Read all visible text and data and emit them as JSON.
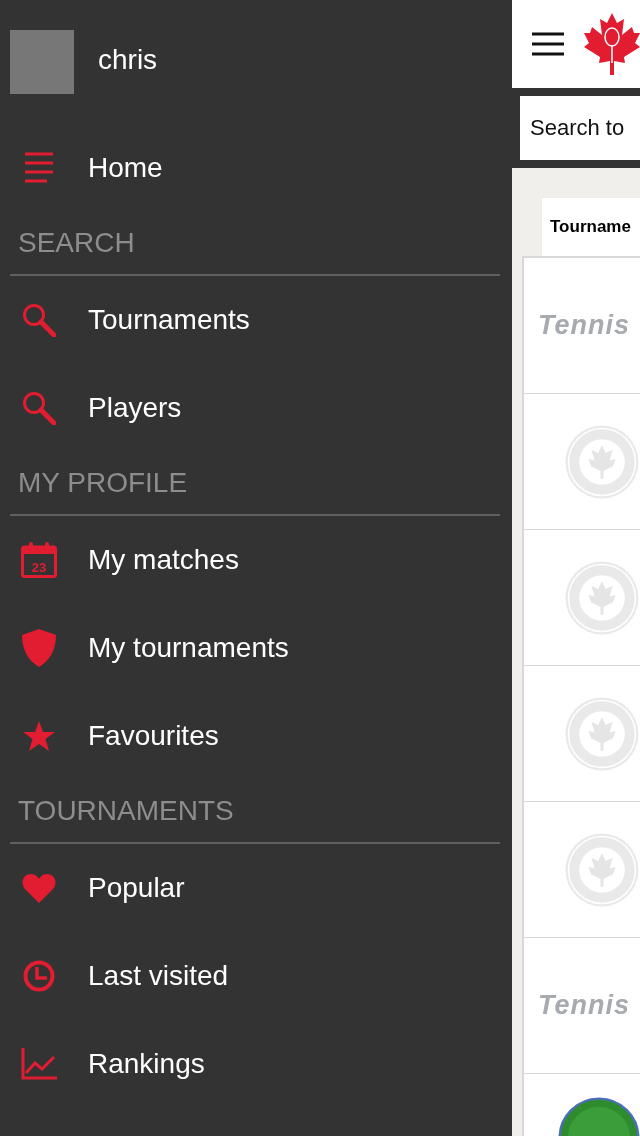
{
  "drawer": {
    "user": {
      "name": "chris"
    },
    "items": [
      {
        "kind": "home",
        "label": "Home"
      },
      {
        "kind": "section",
        "label": "SEARCH"
      },
      {
        "kind": "search",
        "label": "Tournaments"
      },
      {
        "kind": "search",
        "label": "Players"
      },
      {
        "kind": "section",
        "label": "MY PROFILE"
      },
      {
        "kind": "calendar",
        "label": "My matches",
        "icon_text": "23"
      },
      {
        "kind": "shield",
        "label": "My tournaments"
      },
      {
        "kind": "star",
        "label": "Favourites"
      },
      {
        "kind": "section",
        "label": "TOURNAMENTS"
      },
      {
        "kind": "heart",
        "label": "Popular"
      },
      {
        "kind": "clock",
        "label": "Last visited"
      },
      {
        "kind": "chart",
        "label": "Rankings"
      }
    ]
  },
  "main": {
    "search": {
      "placeholder": "Search to"
    },
    "tab": {
      "label": "Tourname"
    },
    "rows": [
      {
        "kind": "wordmark",
        "text": "Tennis"
      },
      {
        "kind": "badge"
      },
      {
        "kind": "badge"
      },
      {
        "kind": "badge"
      },
      {
        "kind": "badge"
      },
      {
        "kind": "wordmark",
        "text": "Tennis"
      },
      {
        "kind": "round"
      }
    ]
  }
}
